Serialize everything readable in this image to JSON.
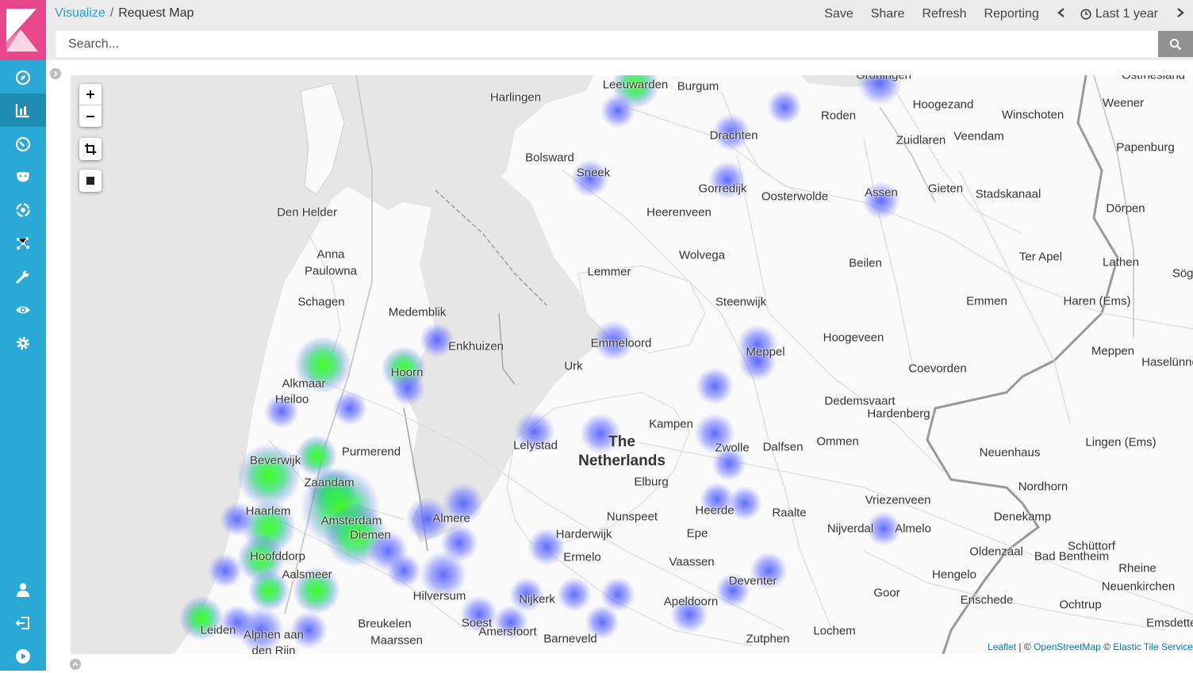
{
  "breadcrumb": {
    "parent": "Visualize",
    "separator": "/",
    "current": "Request Map"
  },
  "menu": {
    "save": "Save",
    "share": "Share",
    "refresh": "Refresh",
    "reporting": "Reporting",
    "time_range": "Last 1 year"
  },
  "search": {
    "placeholder": "Search..."
  },
  "sidebar": {
    "items": [
      "Discover",
      "Visualize",
      "Dashboard",
      "Timelion",
      "Machine Learning",
      "Graph",
      "Dev Tools",
      "Monitoring",
      "Management",
      "User",
      "Logout",
      "Collapse"
    ]
  },
  "map": {
    "country_label": [
      "The",
      "Netherlands"
    ],
    "cities": [
      "Leeuwarden",
      "Burgum",
      "Harlingen",
      "Hoogezand",
      "Winschoten",
      "Weener",
      "Roden",
      "Drachten",
      "Zuidlaren",
      "Veendam",
      "Papenburg",
      "Bolsward",
      "Sneek",
      "Gorredijk",
      "Oosterwolde",
      "Assen",
      "Gieten",
      "Stadskanaal",
      "Heerenveen",
      "Dörpen",
      "Den Helder",
      "Anna",
      "Paulowna",
      "Wolvega",
      "Beilen",
      "Ter Apel",
      "Lathen",
      "Lemmer",
      "Schagen",
      "Medemblik",
      "Steenwijk",
      "Emmen",
      "Haren (Ems)",
      "Enkhuizen",
      "Emmeloord",
      "Meppel",
      "Hoogeveen",
      "Meppen",
      "Haselünne",
      "Hoorn",
      "Urk",
      "Coevorden",
      "Alkmaar",
      "Heiloo",
      "Dedemsvaart",
      "Hardenberg",
      "Kampen",
      "Lelystad",
      "Zwolle",
      "Dalfsen",
      "Ommen",
      "Lingen (Ems)",
      "Beverwijk",
      "Purmerend",
      "Neuenhaus",
      "Zaandam",
      "Elburg",
      "Nordhorn",
      "Haarlem",
      "Vriezenveen",
      "Amsterdam",
      "Diemen",
      "Almere",
      "Nunspeet",
      "Heerde",
      "Raalte",
      "Denekamp",
      "Nijverdal",
      "Almelo",
      "Harderwijk",
      "Epe",
      "Hoofddorp",
      "Ermelo",
      "Vaassen",
      "Oldenzaal",
      "Schüttorf",
      "Bad Bentheim",
      "Aalsmeer",
      "Hengelo",
      "Rheine",
      "Deventer",
      "Neuenkirchen",
      "Hilversum",
      "Nijkerk",
      "Goor",
      "Enschede",
      "Ochtrup",
      "Apeldoorn",
      "Emsdetten",
      "Leiden",
      "Breukelen",
      "Soest",
      "Lochem",
      "Alphen aan",
      "den Rijn",
      "Maarssen",
      "Amersfoort",
      "Barneveld",
      "Zutphen",
      "Sögel",
      "Ostfriesland",
      "Groningen"
    ],
    "attribution": {
      "leaflet": "Leaflet",
      "separator": " | © ",
      "osm": "OpenStreetMap",
      "sep2": " © ",
      "elastic": "Elastic Tile Service"
    }
  },
  "colors": {
    "sidebar": "#2aa9d6",
    "logo_bg": "#e8488b",
    "link": "#2aa0cf",
    "heat_low": "#4d5aff",
    "heat_high": "#39ff14"
  }
}
